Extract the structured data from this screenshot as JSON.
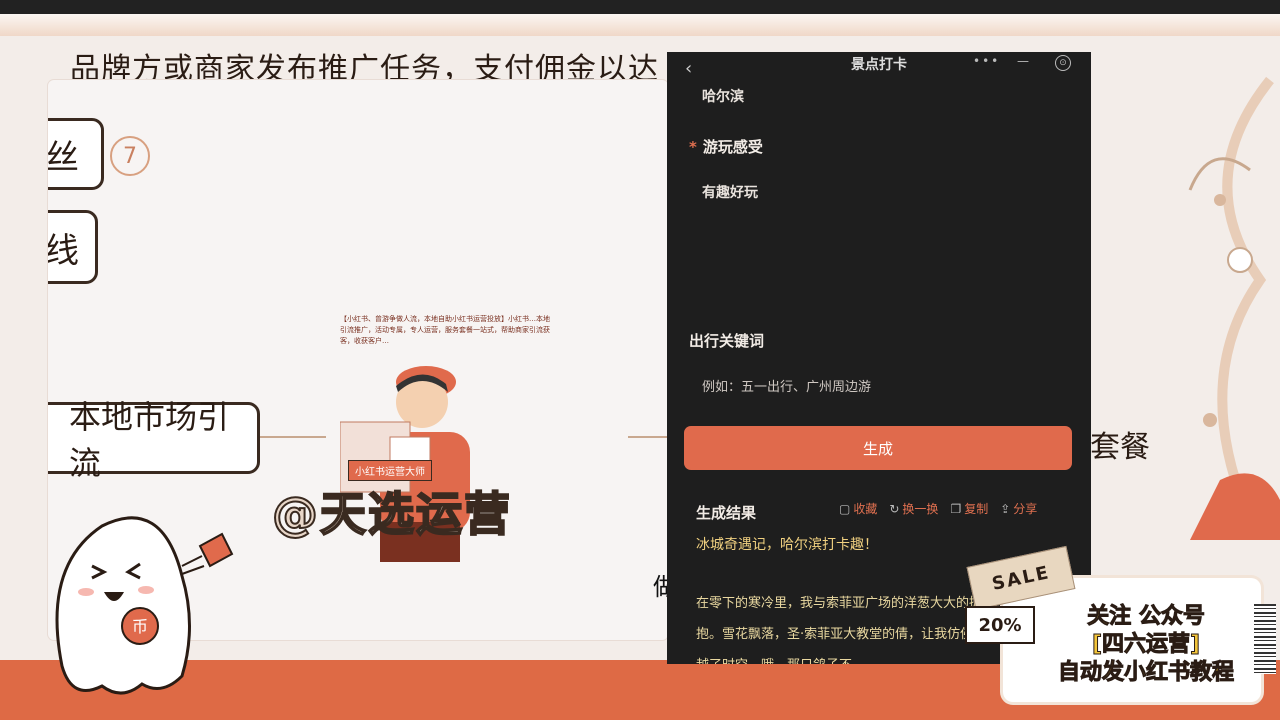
{
  "background": {
    "top_text": "品牌方或商家发布推广任务，支付佣金以达",
    "nodes": {
      "node1": "丝",
      "node1_badge": "7",
      "node2": "线",
      "node3": "本地市场引流"
    },
    "right_caption": "套餐",
    "bottom_caption": "做的",
    "preview_text": "【小红书、曾游争做人流，本地自助小红书运营投放】小红书…本地引流推广，活动专属，专人运营，服务套餐一站式，帮助商家引流获客，收获客户…",
    "preview_badge": "小红书运营大师",
    "watermark": "@天选运营"
  },
  "phone": {
    "title": "景点打卡",
    "more_label": "•••",
    "minimize_label": "—",
    "close_label": "⊙",
    "destination_value": "哈尔滨",
    "experience_label": "游玩感受",
    "experience_required": "*",
    "experience_value": "有趣好玩",
    "keywords_label": "出行关键词",
    "keywords_placeholder": "例如：五一出行、广州周边游",
    "generate_label": "生成",
    "result_title": "生成结果",
    "actions": {
      "favorite": "收藏",
      "refresh": "换一换",
      "copy": "复制",
      "share": "分享"
    },
    "result_headline": "冰城奇遇记，哈尔滨打卡趣！",
    "result_body": "在零下的寒冷里，我与索菲亚广场的洋葱大大的拥抱。雪花飘落，圣·索菲亚大教堂的倩，让我仿佛穿越了时空。哦，那只鸽子不"
  },
  "promo": {
    "sale": "SALE",
    "percent": "20%",
    "line1": "关注 公众号",
    "line2": "[四六运营]",
    "line3": "自动发小红书教程"
  },
  "colors": {
    "accent": "#e06a4c",
    "phone_bg": "#1e1e1e",
    "promo_text": "#f3c53a"
  }
}
